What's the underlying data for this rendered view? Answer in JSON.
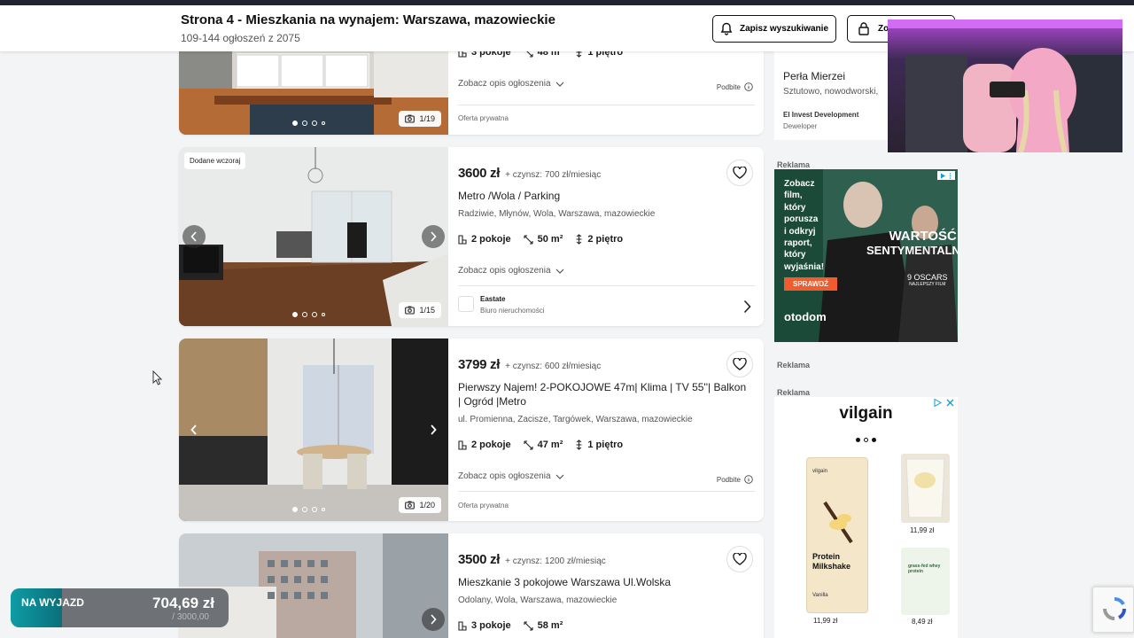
{
  "header": {
    "title": "Strona 4 - Mieszkania na wynajem: Warszawa, mazowieckie",
    "subtitle": "109-144 ogłoszeń z 2075",
    "save_search": "Zapisz wyszukiwanie",
    "second_button": "Zo"
  },
  "listings": [
    {
      "rooms": "3 pokoje",
      "area": "48 m²",
      "floor": "1 piętro",
      "desc_link": "Zobacz opis ogłoszenia",
      "promo": "Podbite",
      "offer_type": "Oferta prywatna",
      "counter": "1/19"
    },
    {
      "badge": "Dodane wczoraj",
      "price": "3600 zł",
      "rent": "+ czynsz: 700 zł/miesiąc",
      "title": "Metro /Wola / Parking",
      "location": "Radziwie, Młynów, Wola, Warszawa, mazowieckie",
      "rooms": "2 pokoje",
      "area": "50 m²",
      "floor": "2 piętro",
      "desc_link": "Zobacz opis ogłoszenia",
      "agency": "Eastate",
      "agency_type": "Biuro nieruchomości",
      "counter": "1/15"
    },
    {
      "price": "3799 zł",
      "rent": "+ czynsz: 600 zł/miesiąc",
      "title": "Pierwszy Najem! 2-POKOJOWE 47m| Klima | TV 55''| Balkon | Ogród |Metro",
      "location": "ul. Promienna, Zacisze, Targówek, Warszawa, mazowieckie",
      "rooms": "2 pokoje",
      "area": "47 m²",
      "floor": "1 piętro",
      "desc_link": "Zobacz opis ogłoszenia",
      "promo": "Podbite",
      "offer_type": "Oferta prywatna",
      "counter": "1/20"
    },
    {
      "price": "3500 zł",
      "rent": "+ czynsz: 1200 zł/miesiąc",
      "title": "Mieszkanie 3 pokojowe Warszawa Ul.Wolska",
      "location": "Odolany, Wola, Warszawa, mazowieckie",
      "rooms": "3 pokoje",
      "area": "58 m²"
    }
  ],
  "sidebar": {
    "dev_name": "Perła Mierzei",
    "dev_location": "Sztutowo, nowodworski,",
    "dev_company": "El Invest Development",
    "dev_type": "Deweloper",
    "ad_label": "Reklama",
    "movie_ad": {
      "lines": [
        "Zobacz",
        "film,",
        "który",
        "porusza",
        "i odkryj",
        "raport,",
        "który",
        "wyjaśnia!"
      ],
      "cta": "SPRAWDŹ",
      "brand": "otodom",
      "film_title_1": "WARTOŚĆ",
      "film_title_2": "SENTYMENTALNA",
      "oscars": "9 OSCARS",
      "oscars_sub": "NAJLEPSZY FILM"
    },
    "vilgain": {
      "brand": "vilgain",
      "main_product": "Protein Milkshake",
      "main_flavor": "Vanilla",
      "main_price": "11,99 zł",
      "p1_price": "11,99 zł",
      "p2_price": "8,49 zł",
      "p2_label": "grass-fed whey protein"
    }
  },
  "widget": {
    "label": "NA WYJAZD",
    "amount": "704,69 zł",
    "goal": "/ 3000,00"
  },
  "colors": {
    "accent_teal": "#0b7f87",
    "otodom_orange": "#ef5c2f",
    "ad_green": "#1a4d3a"
  }
}
